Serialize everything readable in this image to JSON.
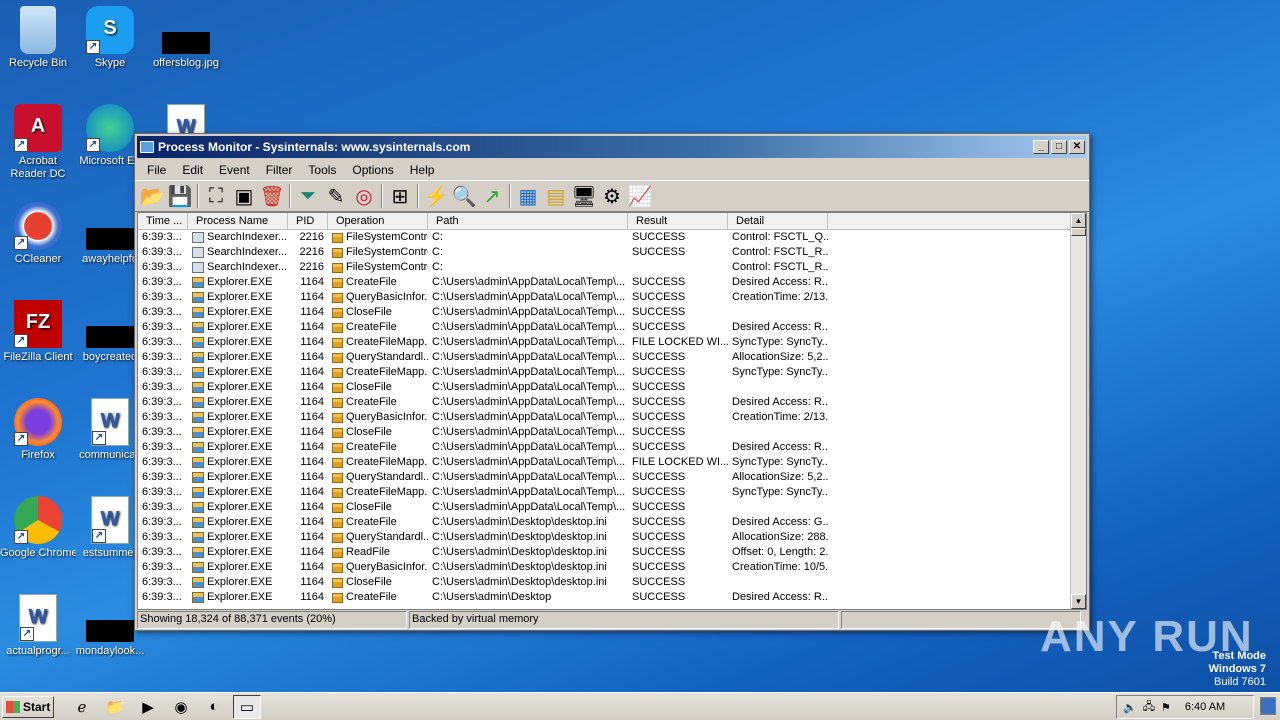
{
  "desktop": {
    "icons": [
      {
        "label": "Recycle Bin",
        "icon": "recycle-bin-icon"
      },
      {
        "label": "Skype",
        "icon": "skype-icon"
      },
      {
        "label": "offersblog.jpg",
        "icon": "image-file-icon"
      },
      {
        "label": "Acrobat Reader DC",
        "icon": "acrobat-icon"
      },
      {
        "label": "Microsoft Ed",
        "icon": "edge-icon"
      },
      {
        "label": "CCleaner",
        "icon": "ccleaner-icon"
      },
      {
        "label": "awayhelpfu",
        "icon": "file-icon"
      },
      {
        "label": "FileZilla Client",
        "icon": "filezilla-icon"
      },
      {
        "label": "boycreated",
        "icon": "file-icon"
      },
      {
        "label": "Firefox",
        "icon": "firefox-icon"
      },
      {
        "label": "communicati",
        "icon": "word-doc-icon"
      },
      {
        "label": "Google Chrome",
        "icon": "chrome-icon"
      },
      {
        "label": "estsummer",
        "icon": "word-doc-icon"
      },
      {
        "label": "actualprogr...",
        "icon": "word-doc-icon"
      },
      {
        "label": "mondaylook...",
        "icon": "file-icon"
      }
    ]
  },
  "window": {
    "title": "Process Monitor - Sysinternals: www.sysinternals.com",
    "controls": {
      "minimize": "_",
      "maximize": "□",
      "close": "✕"
    },
    "menu": [
      "File",
      "Edit",
      "Event",
      "Filter",
      "Tools",
      "Options",
      "Help"
    ],
    "columns": [
      "Time ...",
      "Process Name",
      "PID",
      "Operation",
      "Path",
      "Result",
      "Detail"
    ],
    "rows": [
      [
        "6:39:3...",
        "SearchIndexer....",
        "2216",
        "FileSystemControl",
        "C:",
        "SUCCESS",
        "Control: FSCTL_Q..."
      ],
      [
        "6:39:3...",
        "SearchIndexer....",
        "2216",
        "FileSystemControl",
        "C:",
        "SUCCESS",
        "Control: FSCTL_R..."
      ],
      [
        "6:39:3...",
        "SearchIndexer....",
        "2216",
        "FileSystemControl",
        "C:",
        "",
        "Control: FSCTL_R..."
      ],
      [
        "6:39:3...",
        "Explorer.EXE",
        "1164",
        "CreateFile",
        "C:\\Users\\admin\\AppData\\Local\\Temp\\...",
        "SUCCESS",
        "Desired Access: R..."
      ],
      [
        "6:39:3...",
        "Explorer.EXE",
        "1164",
        "QueryBasicInfor...",
        "C:\\Users\\admin\\AppData\\Local\\Temp\\...",
        "SUCCESS",
        "CreationTime: 2/13..."
      ],
      [
        "6:39:3...",
        "Explorer.EXE",
        "1164",
        "CloseFile",
        "C:\\Users\\admin\\AppData\\Local\\Temp\\...",
        "SUCCESS",
        ""
      ],
      [
        "6:39:3...",
        "Explorer.EXE",
        "1164",
        "CreateFile",
        "C:\\Users\\admin\\AppData\\Local\\Temp\\...",
        "SUCCESS",
        "Desired Access: R..."
      ],
      [
        "6:39:3...",
        "Explorer.EXE",
        "1164",
        "CreateFileMapp...",
        "C:\\Users\\admin\\AppData\\Local\\Temp\\...",
        "FILE LOCKED WI...",
        "SyncType: SyncTy..."
      ],
      [
        "6:39:3...",
        "Explorer.EXE",
        "1164",
        "QueryStandardl...",
        "C:\\Users\\admin\\AppData\\Local\\Temp\\...",
        "SUCCESS",
        "AllocationSize: 5,2..."
      ],
      [
        "6:39:3...",
        "Explorer.EXE",
        "1164",
        "CreateFileMapp...",
        "C:\\Users\\admin\\AppData\\Local\\Temp\\...",
        "SUCCESS",
        "SyncType: SyncTy..."
      ],
      [
        "6:39:3...",
        "Explorer.EXE",
        "1164",
        "CloseFile",
        "C:\\Users\\admin\\AppData\\Local\\Temp\\...",
        "SUCCESS",
        ""
      ],
      [
        "6:39:3...",
        "Explorer.EXE",
        "1164",
        "CreateFile",
        "C:\\Users\\admin\\AppData\\Local\\Temp\\...",
        "SUCCESS",
        "Desired Access: R..."
      ],
      [
        "6:39:3...",
        "Explorer.EXE",
        "1164",
        "QueryBasicInfor...",
        "C:\\Users\\admin\\AppData\\Local\\Temp\\...",
        "SUCCESS",
        "CreationTime: 2/13..."
      ],
      [
        "6:39:3...",
        "Explorer.EXE",
        "1164",
        "CloseFile",
        "C:\\Users\\admin\\AppData\\Local\\Temp\\...",
        "SUCCESS",
        ""
      ],
      [
        "6:39:3...",
        "Explorer.EXE",
        "1164",
        "CreateFile",
        "C:\\Users\\admin\\AppData\\Local\\Temp\\...",
        "SUCCESS",
        "Desired Access: R..."
      ],
      [
        "6:39:3...",
        "Explorer.EXE",
        "1164",
        "CreateFileMapp...",
        "C:\\Users\\admin\\AppData\\Local\\Temp\\...",
        "FILE LOCKED WI...",
        "SyncType: SyncTy..."
      ],
      [
        "6:39:3...",
        "Explorer.EXE",
        "1164",
        "QueryStandardl...",
        "C:\\Users\\admin\\AppData\\Local\\Temp\\...",
        "SUCCESS",
        "AllocationSize: 5,2..."
      ],
      [
        "6:39:3...",
        "Explorer.EXE",
        "1164",
        "CreateFileMapp...",
        "C:\\Users\\admin\\AppData\\Local\\Temp\\...",
        "SUCCESS",
        "SyncType: SyncTy..."
      ],
      [
        "6:39:3...",
        "Explorer.EXE",
        "1164",
        "CloseFile",
        "C:\\Users\\admin\\AppData\\Local\\Temp\\...",
        "SUCCESS",
        ""
      ],
      [
        "6:39:3...",
        "Explorer.EXE",
        "1164",
        "CreateFile",
        "C:\\Users\\admin\\Desktop\\desktop.ini",
        "SUCCESS",
        "Desired Access: G..."
      ],
      [
        "6:39:3...",
        "Explorer.EXE",
        "1164",
        "QueryStandardl...",
        "C:\\Users\\admin\\Desktop\\desktop.ini",
        "SUCCESS",
        "AllocationSize: 288..."
      ],
      [
        "6:39:3...",
        "Explorer.EXE",
        "1164",
        "ReadFile",
        "C:\\Users\\admin\\Desktop\\desktop.ini",
        "SUCCESS",
        "Offset: 0, Length: 2..."
      ],
      [
        "6:39:3...",
        "Explorer.EXE",
        "1164",
        "QueryBasicInfor...",
        "C:\\Users\\admin\\Desktop\\desktop.ini",
        "SUCCESS",
        "CreationTime: 10/5..."
      ],
      [
        "6:39:3...",
        "Explorer.EXE",
        "1164",
        "CloseFile",
        "C:\\Users\\admin\\Desktop\\desktop.ini",
        "SUCCESS",
        ""
      ],
      [
        "6:39:3...",
        "Explorer.EXE",
        "1164",
        "CreateFile",
        "C:\\Users\\admin\\Desktop",
        "SUCCESS",
        "Desired Access: R..."
      ]
    ],
    "status": {
      "events": "Showing 18,324 of 88,371 events (20%)",
      "memory": "Backed by virtual memory"
    }
  },
  "taskbar": {
    "start_label": "Start",
    "clock": "6:40 AM"
  },
  "watermark": {
    "line1": "Test Mode",
    "line2": "Windows 7",
    "line3": "Build 7601",
    "brand": "ANY RUN"
  }
}
